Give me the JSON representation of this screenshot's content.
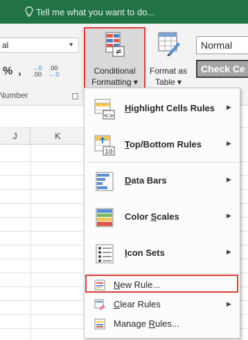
{
  "tellme": {
    "text": "Tell me what you want to do..."
  },
  "ribbon": {
    "number_format": "al",
    "percent": "%",
    "comma": ",",
    "inc_decimal_top": "←0",
    "inc_decimal_bottom": ".00",
    "dec_decimal_top": ".00",
    "dec_decimal_bottom": "→.0",
    "group_label": "Number",
    "conditional_formatting": {
      "line1": "Conditional",
      "line2": "Formatting ▾"
    },
    "format_as_table": {
      "line1": "Format as",
      "line2": "Table ▾"
    },
    "styles": {
      "normal": "Normal",
      "check_cell": "Check Ce"
    }
  },
  "sheet": {
    "columns": [
      "J",
      "K"
    ]
  },
  "menu": {
    "big_items": [
      {
        "pre": "",
        "ul": "H",
        "post": "ighlight Cells Rules",
        "icon": "highlight-cells-icon",
        "has_submenu": true
      },
      {
        "pre": "",
        "ul": "T",
        "post": "op/Bottom Rules",
        "icon": "top-bottom-icon",
        "has_submenu": true
      },
      {
        "pre": "",
        "ul": "D",
        "post": "ata Bars",
        "icon": "data-bars-icon",
        "has_submenu": true
      },
      {
        "pre": "Color ",
        "ul": "S",
        "post": "cales",
        "icon": "color-scales-icon",
        "has_submenu": true
      },
      {
        "pre": "",
        "ul": "I",
        "post": "con Sets",
        "icon": "icon-sets-icon",
        "has_submenu": true
      }
    ],
    "small_items": [
      {
        "pre": "",
        "ul": "N",
        "post": "ew Rule...",
        "icon": "new-rule-icon",
        "has_submenu": false
      },
      {
        "pre": "",
        "ul": "C",
        "post": "lear Rules",
        "icon": "clear-rules-icon",
        "has_submenu": true
      },
      {
        "pre": "Manage ",
        "ul": "R",
        "post": "ules...",
        "icon": "manage-rules-icon",
        "has_submenu": false
      }
    ],
    "submenu_arrow": "▶"
  },
  "colors": {
    "excel_green": "#217346",
    "highlight_red": "#e03c3c"
  }
}
